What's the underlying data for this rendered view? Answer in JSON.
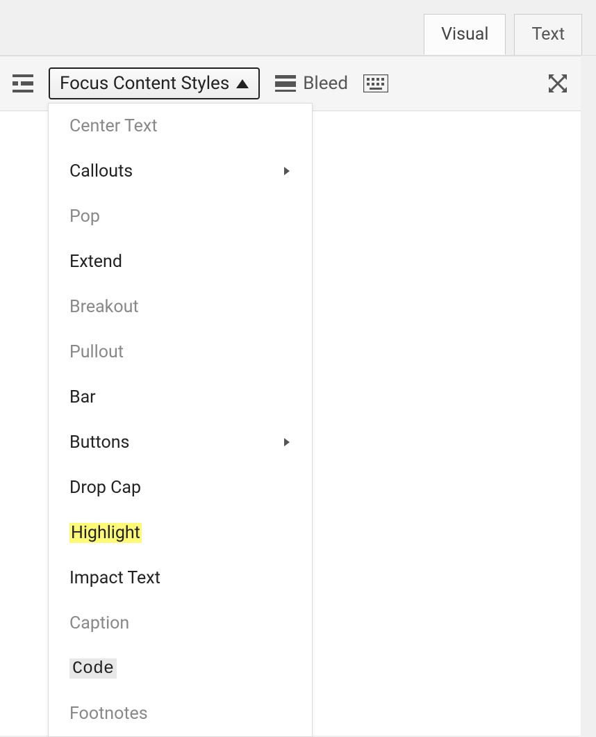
{
  "tabs": {
    "visual": "Visual",
    "text": "Text"
  },
  "toolbar": {
    "dropdown_label": "Focus Content Styles",
    "bleed_label": "Bleed"
  },
  "menu": {
    "center_text": "Center Text",
    "callouts": "Callouts",
    "pop": "Pop",
    "extend": "Extend",
    "breakout": "Breakout",
    "pullout": "Pullout",
    "bar": "Bar",
    "buttons": "Buttons",
    "drop_cap": "Drop Cap",
    "highlight": "Highlight",
    "impact_text": "Impact Text",
    "caption": "Caption",
    "code": "Code",
    "footnotes": "Footnotes"
  }
}
